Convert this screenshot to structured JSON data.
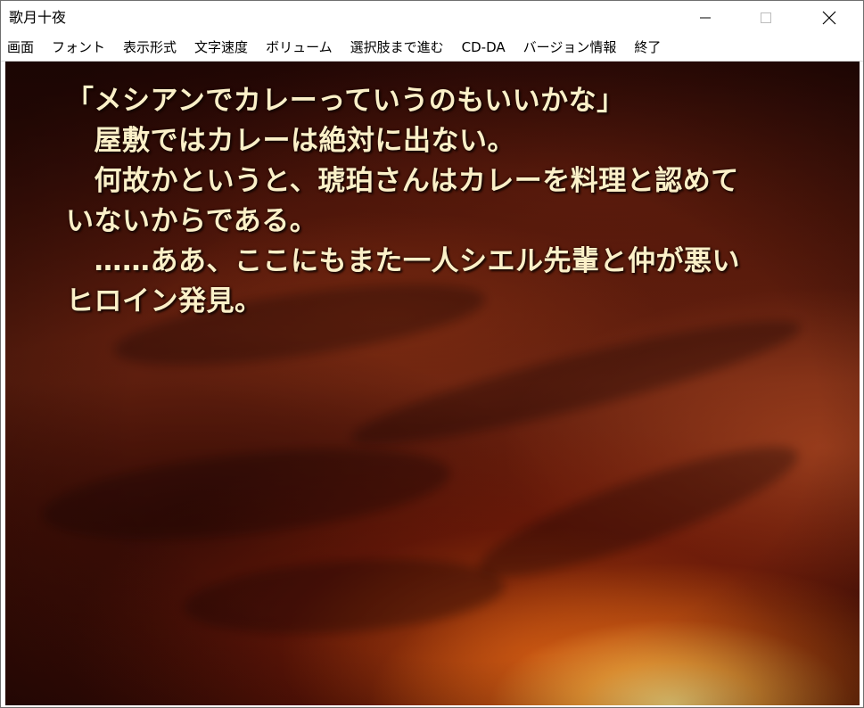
{
  "window": {
    "title": "歌月十夜"
  },
  "menu": {
    "items": [
      {
        "label": "画面"
      },
      {
        "label": "フォント"
      },
      {
        "label": "表示形式"
      },
      {
        "label": "文字速度"
      },
      {
        "label": "ボリューム"
      },
      {
        "label": "選択肢まで進む"
      },
      {
        "label": "CD-DA"
      },
      {
        "label": "バージョン情報"
      },
      {
        "label": "終了"
      }
    ]
  },
  "dialogue": {
    "lines": [
      "「メシアンでカレーっていうのもいいかな」",
      "　屋敷ではカレーは絶対に出ない。",
      "　何故かというと、琥珀さんはカレーを料理と認めて",
      "いないからである。",
      "　……ああ、ここにもまた一人シエル先輩と仲が悪い",
      "ヒロイン発見。"
    ]
  },
  "colors": {
    "text": "#fbf0c8",
    "sky_dark": "#2a0805",
    "sky_glow": "#ffe282"
  },
  "icons": {
    "minimize": "minimize-icon",
    "maximize": "maximize-icon",
    "close": "close-icon"
  }
}
